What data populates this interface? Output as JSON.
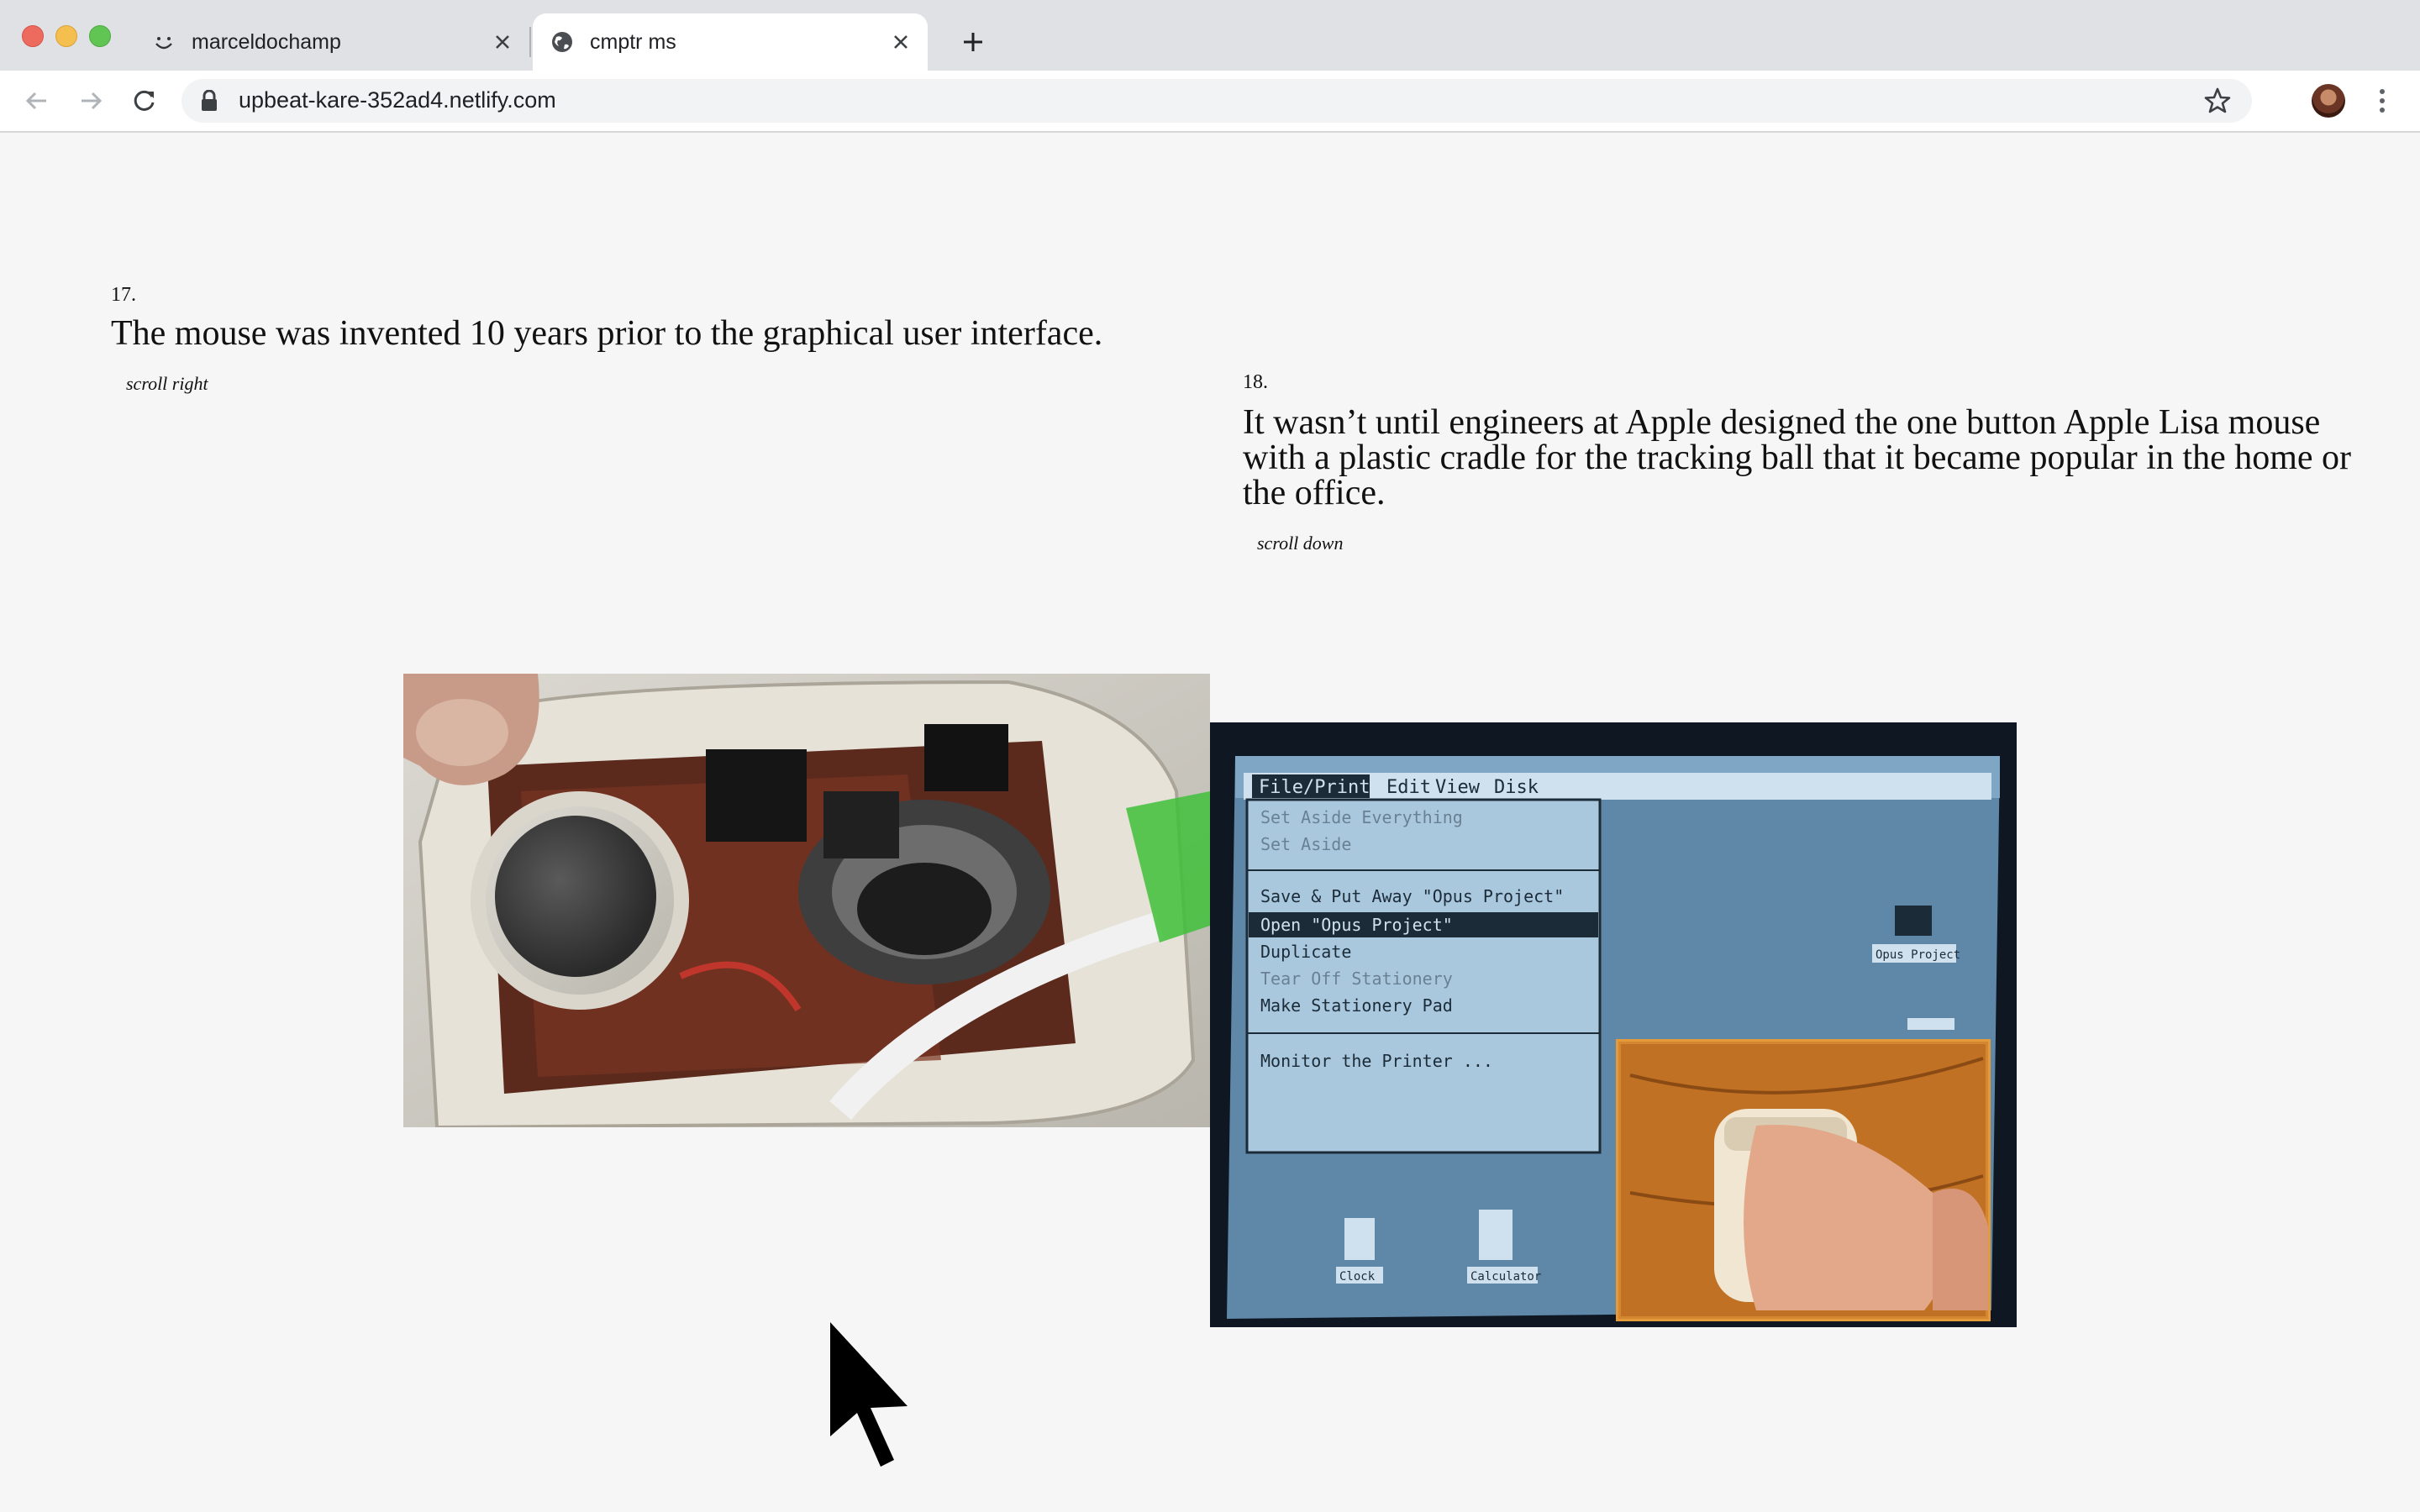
{
  "browser": {
    "tabs": [
      {
        "title": "marceldochamp",
        "favicon": "smiley-face-icon",
        "active": false
      },
      {
        "title": "cmptr ms",
        "favicon": "globe-icon",
        "active": true
      }
    ],
    "url": "upbeat-kare-352ad4.netlify.com"
  },
  "facts": [
    {
      "number": "17.",
      "text": "The mouse was invented 10 years prior to the graphical user interface.",
      "hint": "scroll right"
    },
    {
      "number": "18.",
      "text": "It wasn’t until engineers at Apple designed the one button Apple Lisa mouse with a plastic cradle for the tracking ball that it became popular in the home or the office.",
      "hint": "scroll down"
    }
  ],
  "screen": {
    "menus": [
      "File/Print",
      "Edit",
      "View",
      "Disk"
    ],
    "menu_items": [
      "Set Aside Everything",
      "Set Aside",
      "Save & Put Away \"Opus Project\"",
      "Open \"Opus Project\"",
      "Duplicate",
      "Tear Off Stationery",
      "Make Stationery Pad",
      "Monitor the Printer ..."
    ],
    "icons": [
      "Opus Project",
      "Clock",
      "Calculator"
    ]
  },
  "colors": {
    "page_background": "#f6f6f6",
    "text": "#111111",
    "tabstrip": "#dfe1e5"
  }
}
